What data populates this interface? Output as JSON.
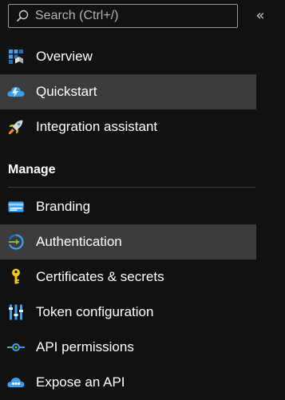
{
  "search": {
    "placeholder": "Search (Ctrl+/)"
  },
  "nav_top": [
    {
      "label": "Overview",
      "icon": "overview-grid-icon"
    },
    {
      "label": "Quickstart",
      "icon": "quickstart-cloud-icon",
      "selected": true
    },
    {
      "label": "Integration assistant",
      "icon": "rocket-icon"
    }
  ],
  "manage": {
    "header": "Manage",
    "items": [
      {
        "label": "Branding",
        "icon": "branding-card-icon"
      },
      {
        "label": "Authentication",
        "icon": "authentication-icon",
        "selected": true
      },
      {
        "label": "Certificates & secrets",
        "icon": "key-icon"
      },
      {
        "label": "Token configuration",
        "icon": "token-bars-icon"
      },
      {
        "label": "API permissions",
        "icon": "api-permissions-icon"
      },
      {
        "label": "Expose an API",
        "icon": "expose-api-cloud-icon"
      }
    ]
  },
  "colors": {
    "background": "#111111",
    "selected": "#3c3c3c",
    "azure_blue": "#3aa0f3",
    "key_yellow": "#f2c811"
  }
}
